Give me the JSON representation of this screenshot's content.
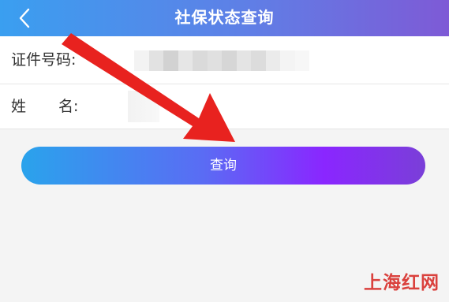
{
  "header": {
    "title": "社保状态查询",
    "back_icon": "chevron-left-icon"
  },
  "form": {
    "id_label": "证件号码:",
    "name_label_first": "姓",
    "name_label_second": "名:"
  },
  "query_button": {
    "label": "查询"
  },
  "watermark": {
    "text": "上海红网"
  },
  "colors": {
    "header_start": "#3a9ff0",
    "header_end": "#7e5ad6",
    "button_start": "#2aa3ec",
    "button_end": "#8a26ff",
    "arrow": "#e8221f",
    "watermark": "#d8322e"
  }
}
